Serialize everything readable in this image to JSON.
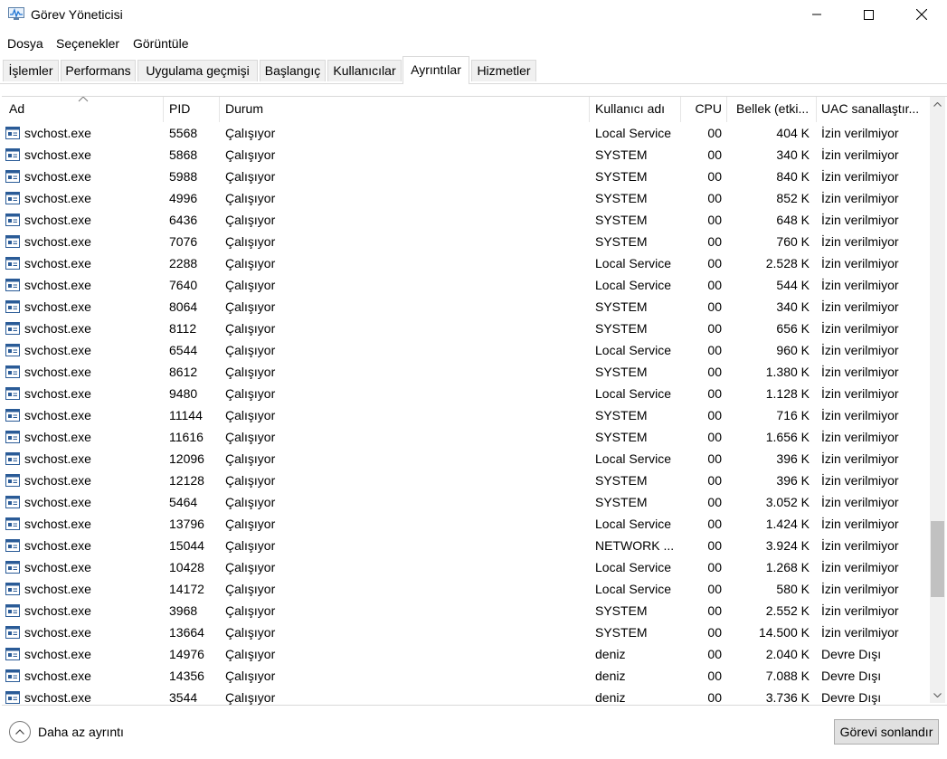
{
  "window": {
    "title": "Görev Yöneticisi"
  },
  "menu": [
    "Dosya",
    "Seçenekler",
    "Görüntüle"
  ],
  "tabs": [
    {
      "label": "İşlemler"
    },
    {
      "label": "Performans"
    },
    {
      "label": "Uygulama geçmişi"
    },
    {
      "label": "Başlangıç"
    },
    {
      "label": "Kullanıcılar"
    },
    {
      "label": "Ayrıntılar",
      "active": true
    },
    {
      "label": "Hizmetler"
    }
  ],
  "columns": {
    "name": "Ad",
    "pid": "PID",
    "status": "Durum",
    "user": "Kullanıcı adı",
    "cpu": "CPU",
    "memory": "Bellek (etki...",
    "uac": "UAC sanallaştır..."
  },
  "rows": [
    {
      "name": "svchost.exe",
      "pid": "5568",
      "status": "Çalışıyor",
      "user": "Local Service",
      "cpu": "00",
      "mem": "404 K",
      "uac": "İzin verilmiyor"
    },
    {
      "name": "svchost.exe",
      "pid": "5868",
      "status": "Çalışıyor",
      "user": "SYSTEM",
      "cpu": "00",
      "mem": "340 K",
      "uac": "İzin verilmiyor"
    },
    {
      "name": "svchost.exe",
      "pid": "5988",
      "status": "Çalışıyor",
      "user": "SYSTEM",
      "cpu": "00",
      "mem": "840 K",
      "uac": "İzin verilmiyor"
    },
    {
      "name": "svchost.exe",
      "pid": "4996",
      "status": "Çalışıyor",
      "user": "SYSTEM",
      "cpu": "00",
      "mem": "852 K",
      "uac": "İzin verilmiyor"
    },
    {
      "name": "svchost.exe",
      "pid": "6436",
      "status": "Çalışıyor",
      "user": "SYSTEM",
      "cpu": "00",
      "mem": "648 K",
      "uac": "İzin verilmiyor"
    },
    {
      "name": "svchost.exe",
      "pid": "7076",
      "status": "Çalışıyor",
      "user": "SYSTEM",
      "cpu": "00",
      "mem": "760 K",
      "uac": "İzin verilmiyor"
    },
    {
      "name": "svchost.exe",
      "pid": "2288",
      "status": "Çalışıyor",
      "user": "Local Service",
      "cpu": "00",
      "mem": "2.528 K",
      "uac": "İzin verilmiyor"
    },
    {
      "name": "svchost.exe",
      "pid": "7640",
      "status": "Çalışıyor",
      "user": "Local Service",
      "cpu": "00",
      "mem": "544 K",
      "uac": "İzin verilmiyor"
    },
    {
      "name": "svchost.exe",
      "pid": "8064",
      "status": "Çalışıyor",
      "user": "SYSTEM",
      "cpu": "00",
      "mem": "340 K",
      "uac": "İzin verilmiyor"
    },
    {
      "name": "svchost.exe",
      "pid": "8112",
      "status": "Çalışıyor",
      "user": "SYSTEM",
      "cpu": "00",
      "mem": "656 K",
      "uac": "İzin verilmiyor"
    },
    {
      "name": "svchost.exe",
      "pid": "6544",
      "status": "Çalışıyor",
      "user": "Local Service",
      "cpu": "00",
      "mem": "960 K",
      "uac": "İzin verilmiyor"
    },
    {
      "name": "svchost.exe",
      "pid": "8612",
      "status": "Çalışıyor",
      "user": "SYSTEM",
      "cpu": "00",
      "mem": "1.380 K",
      "uac": "İzin verilmiyor"
    },
    {
      "name": "svchost.exe",
      "pid": "9480",
      "status": "Çalışıyor",
      "user": "Local Service",
      "cpu": "00",
      "mem": "1.128 K",
      "uac": "İzin verilmiyor"
    },
    {
      "name": "svchost.exe",
      "pid": "11144",
      "status": "Çalışıyor",
      "user": "SYSTEM",
      "cpu": "00",
      "mem": "716 K",
      "uac": "İzin verilmiyor"
    },
    {
      "name": "svchost.exe",
      "pid": "11616",
      "status": "Çalışıyor",
      "user": "SYSTEM",
      "cpu": "00",
      "mem": "1.656 K",
      "uac": "İzin verilmiyor"
    },
    {
      "name": "svchost.exe",
      "pid": "12096",
      "status": "Çalışıyor",
      "user": "Local Service",
      "cpu": "00",
      "mem": "396 K",
      "uac": "İzin verilmiyor"
    },
    {
      "name": "svchost.exe",
      "pid": "12128",
      "status": "Çalışıyor",
      "user": "SYSTEM",
      "cpu": "00",
      "mem": "396 K",
      "uac": "İzin verilmiyor"
    },
    {
      "name": "svchost.exe",
      "pid": "5464",
      "status": "Çalışıyor",
      "user": "SYSTEM",
      "cpu": "00",
      "mem": "3.052 K",
      "uac": "İzin verilmiyor"
    },
    {
      "name": "svchost.exe",
      "pid": "13796",
      "status": "Çalışıyor",
      "user": "Local Service",
      "cpu": "00",
      "mem": "1.424 K",
      "uac": "İzin verilmiyor"
    },
    {
      "name": "svchost.exe",
      "pid": "15044",
      "status": "Çalışıyor",
      "user": "NETWORK ...",
      "cpu": "00",
      "mem": "3.924 K",
      "uac": "İzin verilmiyor"
    },
    {
      "name": "svchost.exe",
      "pid": "10428",
      "status": "Çalışıyor",
      "user": "Local Service",
      "cpu": "00",
      "mem": "1.268 K",
      "uac": "İzin verilmiyor"
    },
    {
      "name": "svchost.exe",
      "pid": "14172",
      "status": "Çalışıyor",
      "user": "Local Service",
      "cpu": "00",
      "mem": "580 K",
      "uac": "İzin verilmiyor"
    },
    {
      "name": "svchost.exe",
      "pid": "3968",
      "status": "Çalışıyor",
      "user": "SYSTEM",
      "cpu": "00",
      "mem": "2.552 K",
      "uac": "İzin verilmiyor"
    },
    {
      "name": "svchost.exe",
      "pid": "13664",
      "status": "Çalışıyor",
      "user": "SYSTEM",
      "cpu": "00",
      "mem": "14.500 K",
      "uac": "İzin verilmiyor"
    },
    {
      "name": "svchost.exe",
      "pid": "14976",
      "status": "Çalışıyor",
      "user": "deniz",
      "cpu": "00",
      "mem": "2.040 K",
      "uac": "Devre Dışı"
    },
    {
      "name": "svchost.exe",
      "pid": "14356",
      "status": "Çalışıyor",
      "user": "deniz",
      "cpu": "00",
      "mem": "7.088 K",
      "uac": "Devre Dışı"
    },
    {
      "name": "svchost.exe",
      "pid": "3544",
      "status": "Çalışıyor",
      "user": "deniz",
      "cpu": "00",
      "mem": "3.736 K",
      "uac": "Devre Dışı"
    }
  ],
  "footer": {
    "less_details": "Daha az ayrıntı",
    "end_task": "Görevi sonlandır"
  },
  "icons": {
    "app": "task-manager-icon",
    "process": "service-host-icon"
  }
}
